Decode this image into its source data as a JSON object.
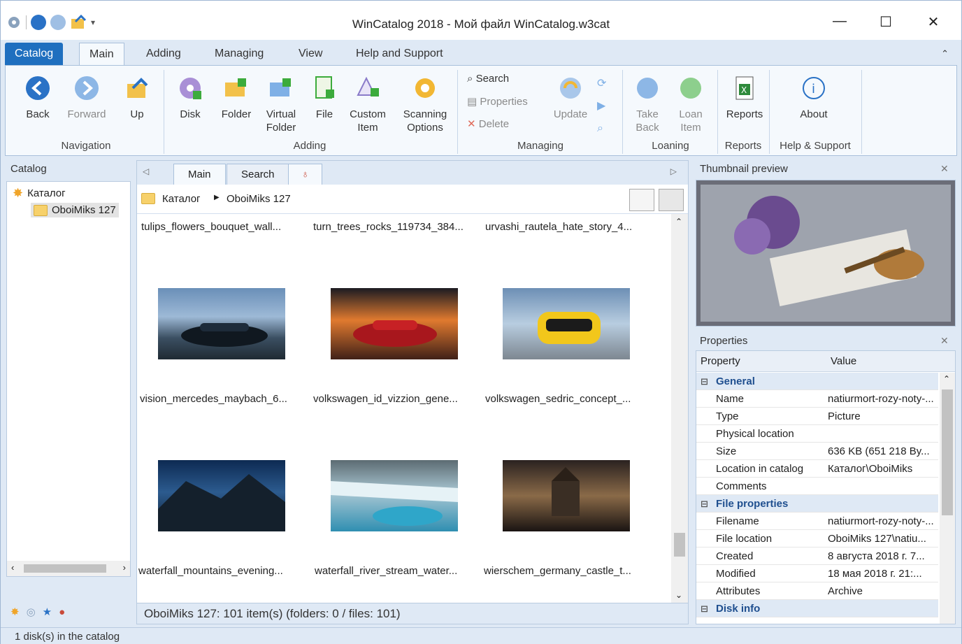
{
  "window": {
    "title": "WinCatalog 2018 - Мой файл WinCatalog.w3cat"
  },
  "ribbon_tabs": [
    "Catalog",
    "Main",
    "Adding",
    "Managing",
    "View",
    "Help and Support"
  ],
  "navigation": {
    "back": "Back",
    "forward": "Forward",
    "up": "Up",
    "group": "Navigation"
  },
  "adding": {
    "disk": "Disk",
    "folder": "Folder",
    "virtual_folder_1": "Virtual",
    "virtual_folder_2": "Folder",
    "file": "File",
    "custom_item_1": "Custom",
    "custom_item_2": "Item",
    "scanning_1": "Scanning",
    "scanning_2": "Options",
    "group": "Adding"
  },
  "managing": {
    "search": "Search",
    "properties": "Properties",
    "delete": "Delete",
    "update": "Update",
    "group": "Managing"
  },
  "loaning": {
    "take_back_1": "Take",
    "take_back_2": "Back",
    "loan_item_1": "Loan",
    "loan_item_2": "Item",
    "group": "Loaning"
  },
  "reports": {
    "reports": "Reports",
    "group": "Reports"
  },
  "help": {
    "about": "About",
    "group": "Help & Support"
  },
  "catalog_panel": {
    "title": "Catalog",
    "root": "Каталог",
    "child": "OboiMiks 127"
  },
  "doc_tabs": [
    "Main",
    "Search"
  ],
  "path": {
    "root": "Каталог",
    "child": "OboiMiks 127"
  },
  "items": [
    {
      "caption": "tulips_flowers_bouquet_wall..."
    },
    {
      "caption": "turn_trees_rocks_119734_384..."
    },
    {
      "caption": "urvashi_rautela_hate_story_4..."
    },
    {
      "caption": "vision_mercedes_maybach_6..."
    },
    {
      "caption": "volkswagen_id_vizzion_gene..."
    },
    {
      "caption": "volkswagen_sedric_concept_..."
    },
    {
      "caption": "waterfall_mountains_evening..."
    },
    {
      "caption": "waterfall_river_stream_water..."
    },
    {
      "caption": "wierschem_germany_castle_t..."
    }
  ],
  "center_status": "OboiMiks 127: 101 item(s) (folders: 0 / files: 101)",
  "thumbnail_panel": {
    "title": "Thumbnail preview"
  },
  "properties_panel": {
    "title": "Properties",
    "col_property": "Property",
    "col_value": "Value",
    "general": "General",
    "rows_general": [
      {
        "k": "Name",
        "v": "natiurmort-rozy-noty-..."
      },
      {
        "k": "Type",
        "v": "Picture"
      },
      {
        "k": "Physical location",
        "v": ""
      },
      {
        "k": "Size",
        "v": "636 KB (651 218 By..."
      },
      {
        "k": "Location in catalog",
        "v": "Каталог\\OboiMiks"
      },
      {
        "k": "Comments",
        "v": ""
      }
    ],
    "file_properties": "File properties",
    "rows_file": [
      {
        "k": "Filename",
        "v": "natiurmort-rozy-noty-..."
      },
      {
        "k": "File location",
        "v": "OboiMiks 127\\natiu..."
      },
      {
        "k": "Created",
        "v": "8 августа 2018 г. 7..."
      },
      {
        "k": "Modified",
        "v": "18 мая 2018 г. 21:..."
      },
      {
        "k": "Attributes",
        "v": "Archive"
      }
    ],
    "disk_info": "Disk info"
  },
  "statusbar": {
    "text": "1 disk(s) in the catalog"
  },
  "colors": {
    "accent": "#1f6fbf",
    "panel": "#dfe9f5"
  }
}
